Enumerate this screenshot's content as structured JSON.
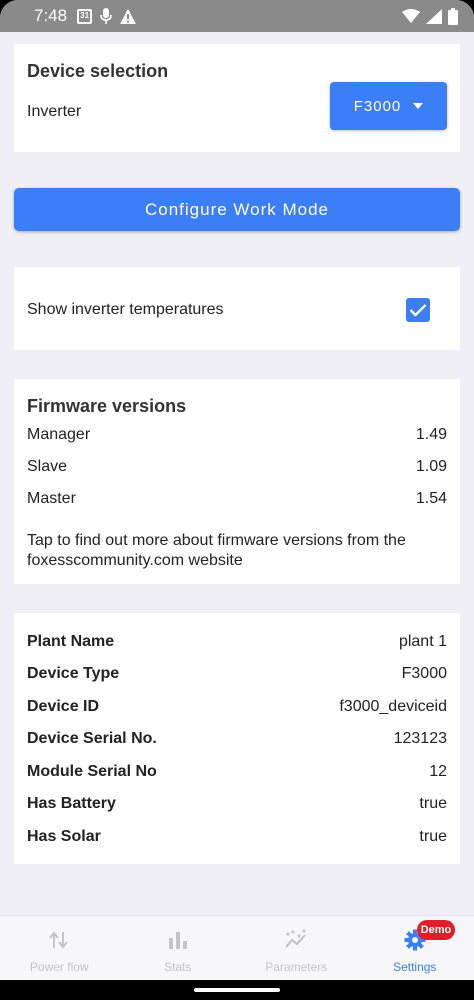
{
  "status_bar": {
    "time": "7:48",
    "calendar_day": "31",
    "icons": [
      "calendar-icon",
      "mic-icon",
      "warning-icon",
      "wifi-icon",
      "signal-icon",
      "battery-icon"
    ]
  },
  "device_selection": {
    "title": "Device selection",
    "inverter_label": "Inverter",
    "inverter_value": "F3000"
  },
  "configure_button": "Configure Work Mode",
  "temperatures": {
    "label": "Show inverter temperatures",
    "checked": true
  },
  "firmware": {
    "title": "Firmware versions",
    "rows": [
      {
        "label": "Manager",
        "value": "1.49"
      },
      {
        "label": "Slave",
        "value": "1.09"
      },
      {
        "label": "Master",
        "value": "1.54"
      }
    ],
    "link_text": "Tap to find out more about firmware versions from the foxesscommunity.com website"
  },
  "device_info": {
    "rows": [
      {
        "label": "Plant Name",
        "value": "plant 1"
      },
      {
        "label": "Device Type",
        "value": "F3000"
      },
      {
        "label": "Device ID",
        "value": "f3000_deviceid"
      },
      {
        "label": "Device Serial No.",
        "value": "123123"
      },
      {
        "label": "Module Serial No",
        "value": "12"
      },
      {
        "label": "Has Battery",
        "value": "true"
      },
      {
        "label": "Has Solar",
        "value": "true"
      }
    ]
  },
  "bottom_nav": {
    "items": [
      {
        "label": "Power flow",
        "icon": "power-flow-icon"
      },
      {
        "label": "Stats",
        "icon": "stats-icon"
      },
      {
        "label": "Parameters",
        "icon": "parameters-icon"
      },
      {
        "label": "Settings",
        "icon": "gear-icon",
        "active": true
      }
    ],
    "badge": "Demo"
  },
  "colors": {
    "accent": "#3b7ef5",
    "badge": "#e11d2a",
    "background": "#f0eff6"
  }
}
